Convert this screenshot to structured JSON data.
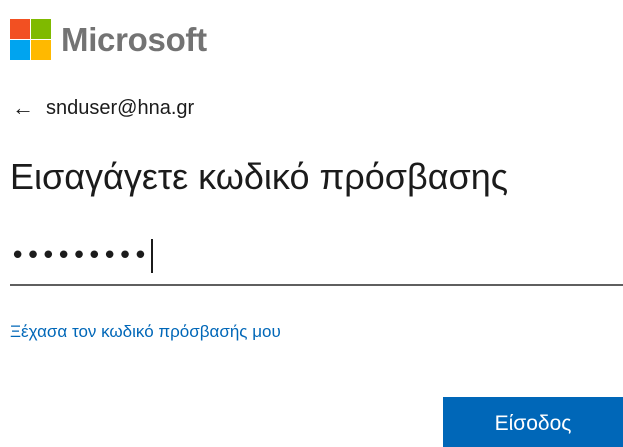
{
  "brand": {
    "name": "Microsoft",
    "logo_colors": [
      "#f25022",
      "#7fba00",
      "#00a4ef",
      "#ffb900"
    ]
  },
  "identity": {
    "back_icon": "arrow-left-icon",
    "email": "snduser@hna.gr"
  },
  "title": "Εισαγάγετε κωδικό πρόσβασης",
  "password": {
    "masked_value": "•••••••••"
  },
  "forgot_link": "Ξέχασα τον κωδικό πρόσβασής μου",
  "signin_button": "Είσοδος",
  "colors": {
    "accent": "#0067b8",
    "text": "#1b1b1b",
    "logo_text": "#737373"
  }
}
